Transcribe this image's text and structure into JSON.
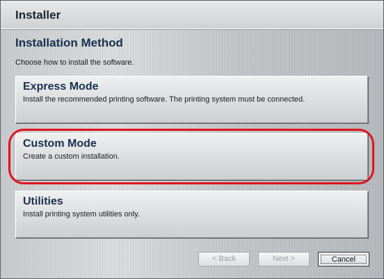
{
  "window": {
    "title": "Installer"
  },
  "page": {
    "heading": "Installation Method",
    "subtitle": "Choose how to install the software."
  },
  "options": [
    {
      "title": "Express Mode",
      "description": "Install the recommended printing software. The printing system must be connected."
    },
    {
      "title": "Custom Mode",
      "description": "Create a custom installation."
    },
    {
      "title": "Utilities",
      "description": "Install printing system utilities only."
    }
  ],
  "buttons": {
    "back": "< Back",
    "next": "Next >",
    "cancel": "Cancel"
  },
  "colors": {
    "highlight": "#e0121b",
    "heading_text": "#18304d"
  }
}
